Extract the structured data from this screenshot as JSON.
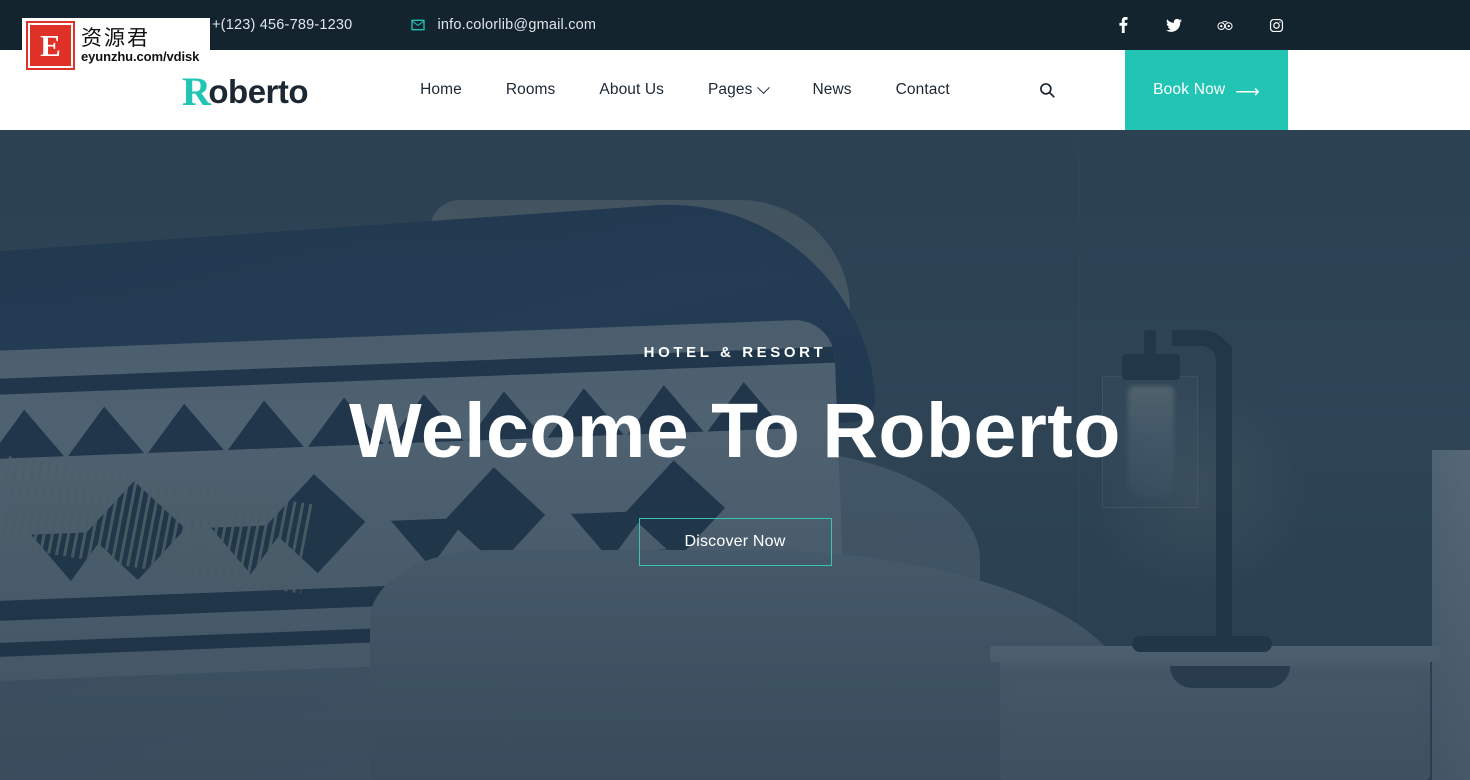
{
  "topbar": {
    "phone": "+(123) 456-789-1230",
    "email": "info.colorlib@gmail.com",
    "phone_icon": "phone-icon",
    "email_icon": "envelope-icon",
    "socials": [
      {
        "name": "facebook-icon",
        "label": "Facebook"
      },
      {
        "name": "twitter-icon",
        "label": "Twitter"
      },
      {
        "name": "tripadvisor-icon",
        "label": "TripAdvisor"
      },
      {
        "name": "instagram-icon",
        "label": "Instagram"
      }
    ]
  },
  "header": {
    "logo_mark": "R",
    "logo_text": "oberto",
    "nav": [
      {
        "label": "Home",
        "has_dropdown": false
      },
      {
        "label": "Rooms",
        "has_dropdown": false
      },
      {
        "label": "About Us",
        "has_dropdown": false
      },
      {
        "label": "Pages",
        "has_dropdown": true
      },
      {
        "label": "News",
        "has_dropdown": false
      },
      {
        "label": "Contact",
        "has_dropdown": false
      }
    ],
    "search_icon": "search-icon",
    "book_now_label": "Book Now",
    "book_now_arrow": "⟶"
  },
  "hero": {
    "kicker": "HOTEL & RESORT",
    "title": "Welcome To Roberto",
    "cta_label": "Discover Now"
  },
  "watermark": {
    "mark": "E",
    "cn_text": "资源君",
    "url": "eyunzhu.com/vdisk"
  },
  "colors": {
    "accent_teal": "#22c4b4",
    "topbar_dark": "#13242f",
    "hero_overlay": "#263e52",
    "cta_border": "#32c6b3",
    "watermark_red": "#e03128"
  }
}
